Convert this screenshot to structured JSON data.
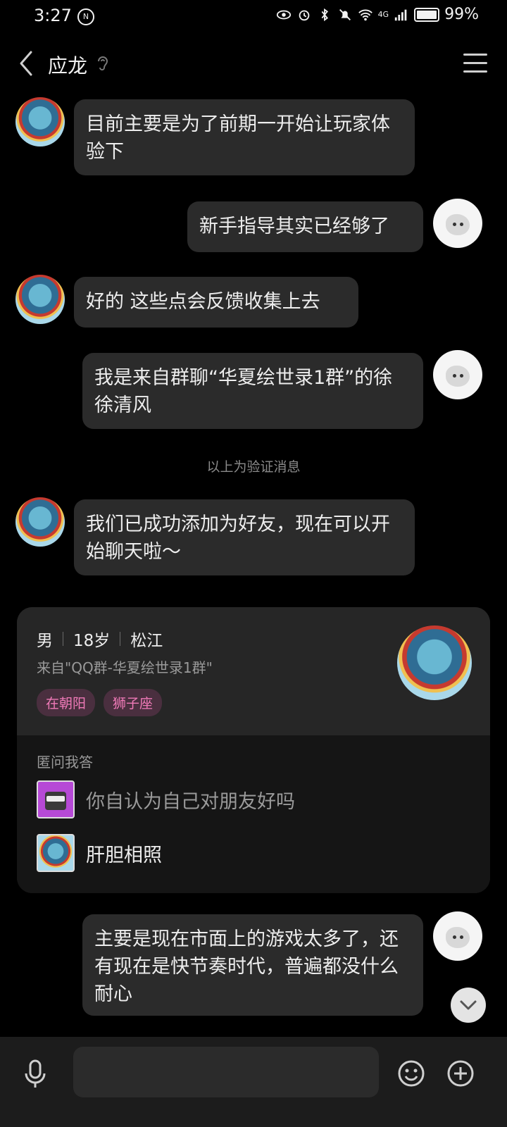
{
  "status_bar": {
    "time": "3:27",
    "time_badge": "N",
    "network": "4G",
    "battery": "99%"
  },
  "header": {
    "title": "应龙"
  },
  "messages": [
    {
      "side": "left",
      "text": "目前主要是为了前期一开始让玩家体验下"
    },
    {
      "side": "right",
      "text": "新手指导其实已经够了"
    },
    {
      "side": "left",
      "text": "好的 这些点会反馈收集上去"
    },
    {
      "side": "right",
      "text": "我是来自群聊“华夏绘世录1群”的徐徐清风"
    },
    {
      "side": "left",
      "text": "我们已成功添加为好友，现在可以开始聊天啦～"
    },
    {
      "side": "right",
      "text": "主要是现在市面上的游戏太多了，还有现在是快节奏时代，普遍都没什么耐心"
    }
  ],
  "system_message": "以上为验证消息",
  "profile_card": {
    "gender": "男",
    "age": "18岁",
    "location": "松江",
    "source": "来自\"QQ群-华夏绘世录1群\"",
    "tags": [
      "在朝阳",
      "狮子座"
    ],
    "qa_title": "匿问我答",
    "question": "你自认为自己对朋友好吗",
    "answer": "肝胆相照"
  },
  "colors": {
    "background": "#000000",
    "bubble": "#2b2b2b",
    "tag_text": "#f07ab8",
    "tag_bg": "#4a2f3f"
  }
}
